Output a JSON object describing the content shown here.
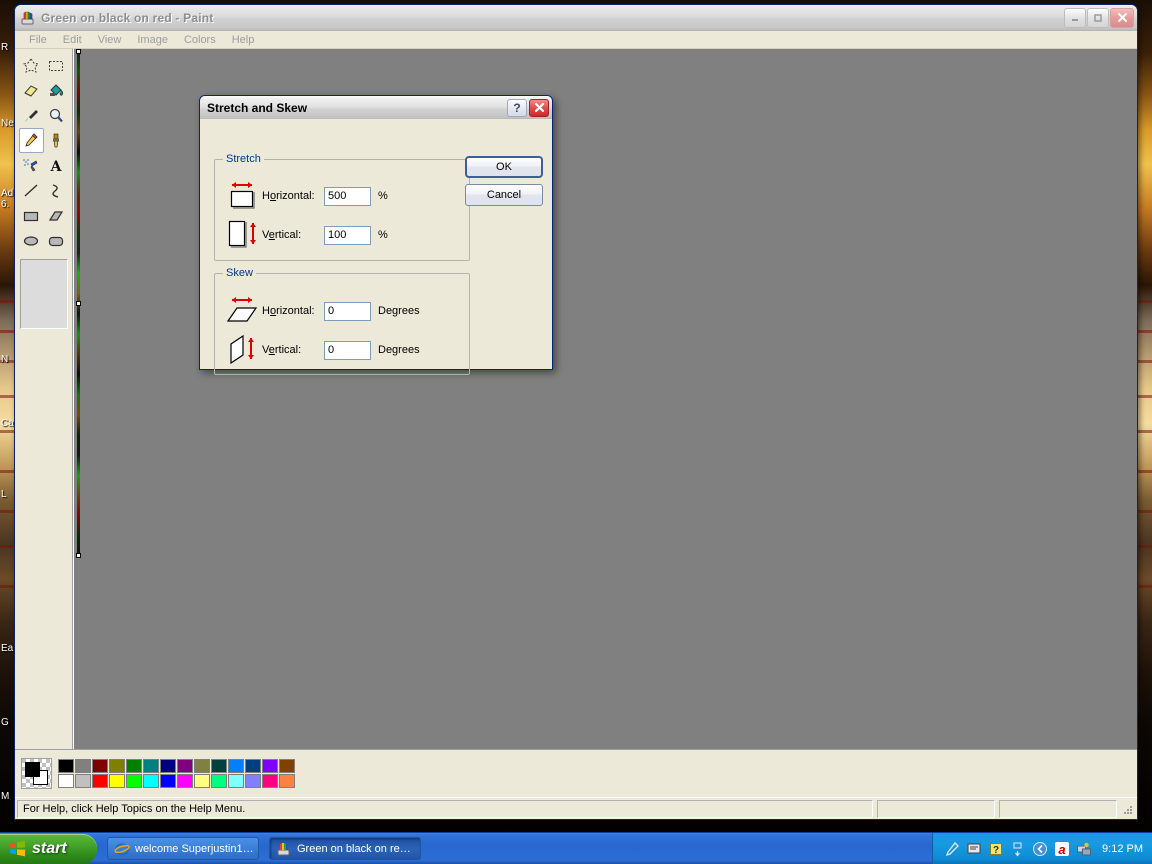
{
  "window": {
    "title": "Green on black on red - Paint",
    "app_icon": "paint-icon",
    "controls": {
      "minimize": "–",
      "maximize": "□",
      "close": "✕"
    }
  },
  "menubar": {
    "items": [
      {
        "label": "File"
      },
      {
        "label": "Edit"
      },
      {
        "label": "View"
      },
      {
        "label": "Image"
      },
      {
        "label": "Colors"
      },
      {
        "label": "Help"
      }
    ]
  },
  "toolbox": {
    "tools": [
      {
        "name": "free-form-select-tool",
        "selected": false
      },
      {
        "name": "rectangle-select-tool",
        "selected": false
      },
      {
        "name": "eraser-tool",
        "selected": false
      },
      {
        "name": "fill-with-color-tool",
        "selected": false
      },
      {
        "name": "pick-color-tool",
        "selected": false
      },
      {
        "name": "magnifier-tool",
        "selected": false
      },
      {
        "name": "pencil-tool",
        "selected": true
      },
      {
        "name": "brush-tool",
        "selected": false
      },
      {
        "name": "airbrush-tool",
        "selected": false
      },
      {
        "name": "text-tool",
        "selected": false
      },
      {
        "name": "line-tool",
        "selected": false
      },
      {
        "name": "curve-tool",
        "selected": false
      },
      {
        "name": "rectangle-tool",
        "selected": false
      },
      {
        "name": "polygon-tool",
        "selected": false
      },
      {
        "name": "ellipse-tool",
        "selected": false
      },
      {
        "name": "rounded-rectangle-tool",
        "selected": false
      }
    ]
  },
  "palette": {
    "foreground": "#000000",
    "background": "#ffffff",
    "row1": [
      "#000000",
      "#808080",
      "#800000",
      "#808000",
      "#008000",
      "#008080",
      "#000080",
      "#800080",
      "#808040",
      "#004040",
      "#0080ff",
      "#004080",
      "#8000ff",
      "#804000"
    ],
    "row2": [
      "#ffffff",
      "#c0c0c0",
      "#ff0000",
      "#ffff00",
      "#00ff00",
      "#00ffff",
      "#0000ff",
      "#ff00ff",
      "#ffff80",
      "#00ff80",
      "#80ffff",
      "#8080ff",
      "#ff0080",
      "#ff8040"
    ]
  },
  "statusbar": {
    "help_text": "For Help, click Help Topics on the Help Menu.",
    "panel_b": "",
    "panel_c": ""
  },
  "dialog": {
    "title": "Stretch and Skew",
    "help_button": "?",
    "close_button": "✕",
    "stretch": {
      "legend": "Stretch",
      "horizontal": {
        "label_pre": "H",
        "label_key": "o",
        "label_post": "rizontal:",
        "value": "500",
        "unit": "%",
        "icon": "stretch-horizontal-icon"
      },
      "vertical": {
        "label_pre": "V",
        "label_key": "e",
        "label_post": "rtical:",
        "value": "100",
        "unit": "%",
        "icon": "stretch-vertical-icon"
      }
    },
    "skew": {
      "legend": "Skew",
      "horizontal": {
        "label_pre": "H",
        "label_key": "o",
        "label_post": "rizontal:",
        "value": "0",
        "unit": "Degrees",
        "icon": "skew-horizontal-icon"
      },
      "vertical": {
        "label_pre": "V",
        "label_key": "e",
        "label_post": "rtical:",
        "value": "0",
        "unit": "Degrees",
        "icon": "skew-vertical-icon"
      }
    },
    "ok_label": "OK",
    "cancel_label": "Cancel"
  },
  "desktop": {
    "icon_labels": [
      "R",
      "Ne",
      "Ad",
      "6.",
      "N",
      "Ca",
      "L",
      "Ea",
      "G",
      "M"
    ]
  },
  "taskbar": {
    "start_label": "start",
    "buttons": [
      {
        "label": "welcome Superjustin1…",
        "icon": "internet-explorer-icon",
        "active": false
      },
      {
        "label": "Green on black on re…",
        "icon": "paint-icon",
        "active": true
      }
    ],
    "tray": {
      "icons": [
        "pen-icon",
        "notes-icon",
        "help-icon",
        "show-hidden-icon",
        "volume-icon",
        "antivirus-icon",
        "network-icon"
      ],
      "clock": "9:12 PM"
    }
  }
}
